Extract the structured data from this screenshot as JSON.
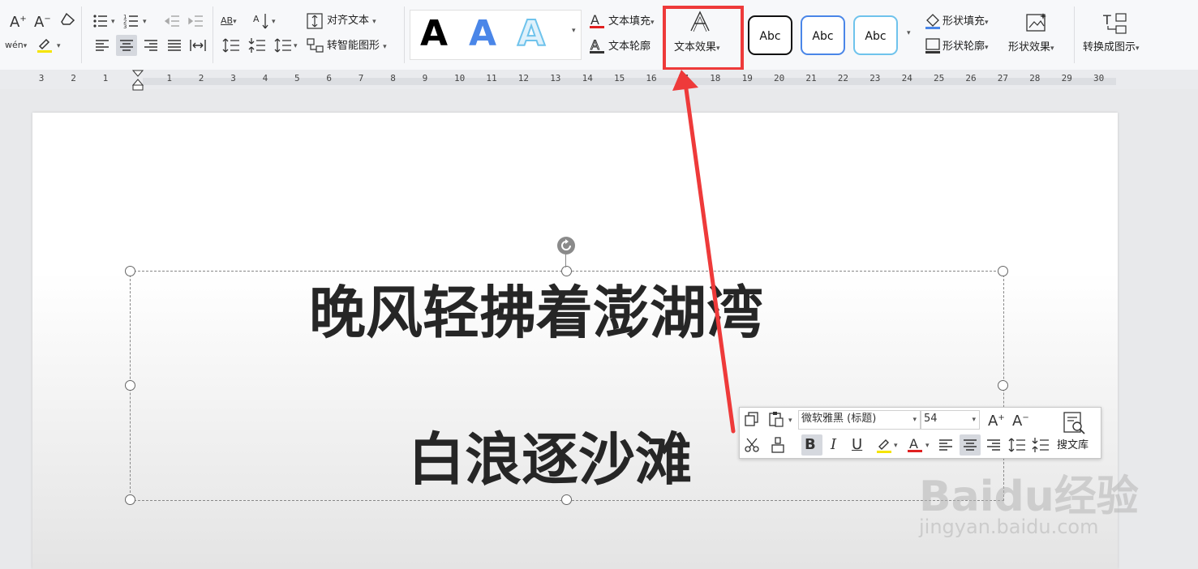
{
  "ribbon": {
    "align_text": "对齐文本",
    "smart_shape": "转智能图形",
    "text_fill": "文本填充",
    "text_outline": "文本轮廓",
    "text_effects": "文本效果",
    "shape_fill": "形状填充",
    "shape_outline": "形状轮廓",
    "shape_effects": "形状效果",
    "convert_diagram": "转换成图示",
    "wordart_glyph": "A",
    "shape_style_label": "Abc",
    "pinyin_glyph": "wén",
    "tracking_glyph": "AB"
  },
  "ruler": {
    "numbers": [
      "3",
      "2",
      "1",
      "1",
      "2",
      "3",
      "4",
      "5",
      "6",
      "7",
      "8",
      "9",
      "10",
      "11",
      "12",
      "13",
      "14",
      "15",
      "16",
      "17",
      "18",
      "19",
      "20",
      "21",
      "22",
      "23",
      "24",
      "25",
      "26",
      "27",
      "28",
      "29",
      "30"
    ]
  },
  "document": {
    "line1": "晚风轻拂着澎湖湾",
    "line2": "白浪逐沙滩"
  },
  "mini_toolbar": {
    "font": "微软雅黑 (标题)",
    "size": "54",
    "search_lib": "搜文库"
  },
  "watermark": {
    "logo": "Baidu经验",
    "url": "jingyan.baidu.com"
  },
  "colors": {
    "highlight_box": "#ee3a3a",
    "arrow": "#ee3a3a",
    "font_color_bar": "#e02020",
    "highlight_bar": "#f5e400",
    "wordart_blue": "#4a86e8"
  }
}
